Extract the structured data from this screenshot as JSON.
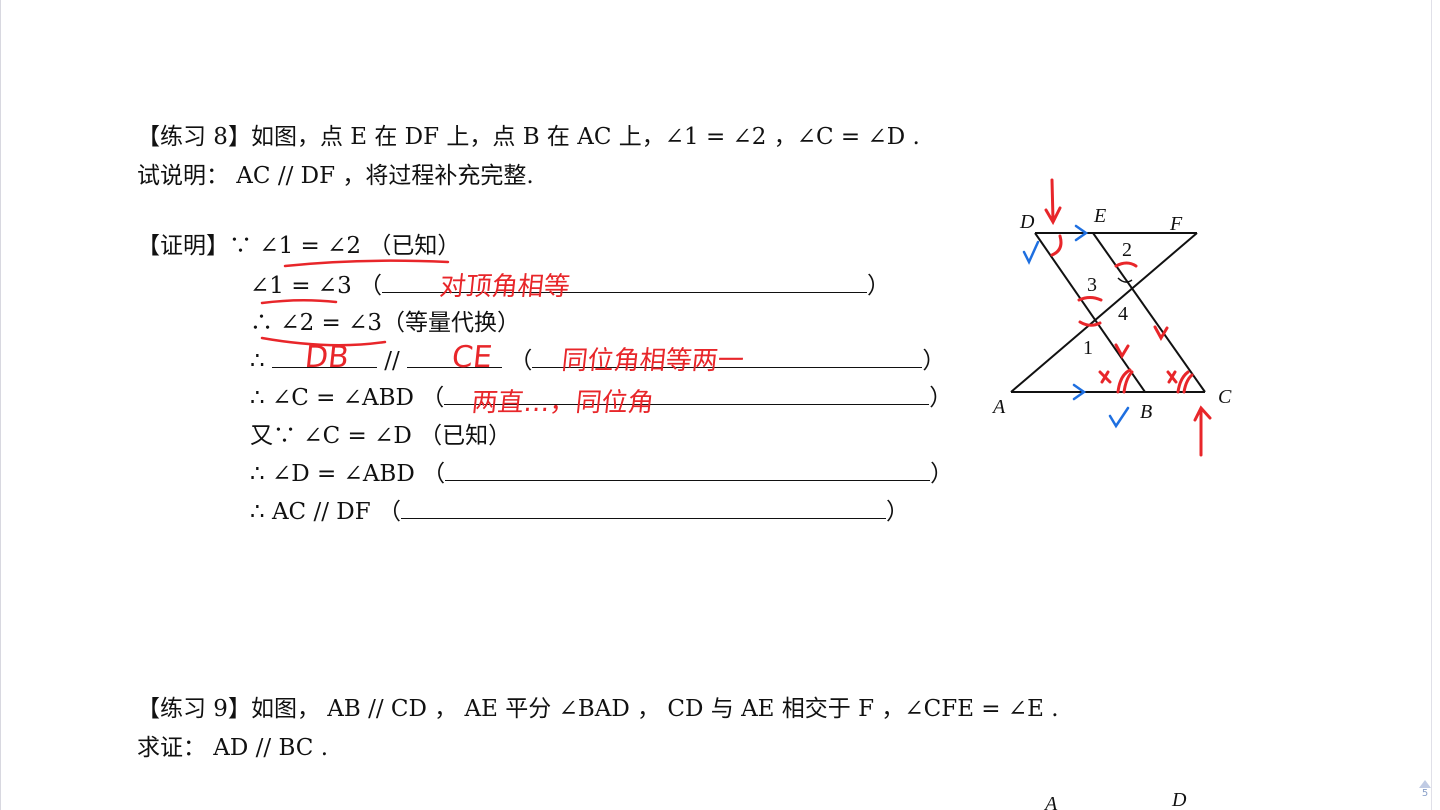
{
  "ex8": {
    "line1": "【练习 8】如图，点 E 在 DF 上，点 B 在 AC 上，∠1 = ∠2 ，∠C = ∠D .",
    "line2": "试说明： AC // DF ，将过程补充完整.",
    "proof_label": "【证明】∵",
    "steps": [
      {
        "text": "∠1 = ∠2",
        "reason": "（已知）"
      },
      {
        "text": "∠1 = ∠3",
        "open": "（",
        "close": "）",
        "handwritten": "对顶角相等"
      },
      {
        "text": "∴ ∠2 = ∠3",
        "reason": "（等量代换）"
      },
      {
        "text": "∴",
        "mid": "//",
        "open": "（",
        "close": "）",
        "handwritten_a": "DB",
        "handwritten_b": "CE",
        "handwritten": "同位角相等两一"
      },
      {
        "text": "∴ ∠C = ∠ABD",
        "open": "（",
        "close": "）",
        "handwritten": "两直…，同位角"
      },
      {
        "text": "又∵ ∠C = ∠D",
        "reason": "（已知）"
      },
      {
        "text": "∴ ∠D = ∠ABD",
        "open": "（",
        "close": "）"
      },
      {
        "text": "∴ AC // DF",
        "open": "（",
        "close": "）"
      }
    ]
  },
  "figure8": {
    "labels": {
      "D": "D",
      "E": "E",
      "F": "F",
      "A": "A",
      "B": "B",
      "C": "C",
      "n1": "1",
      "n2": "2",
      "n3": "3",
      "n4": "4"
    },
    "annotation_colors": {
      "red": "#e8262a",
      "blue": "#1e6fe0"
    }
  },
  "ex9": {
    "line1": "【练习 9】如图， AB // CD ， AE 平分 ∠BAD ， CD 与 AE 相交于 F ，∠CFE = ∠E .",
    "line2": "求证： AD // BC .",
    "fig_labels": {
      "A": "A",
      "D": "D"
    }
  },
  "page_indicator": "5"
}
